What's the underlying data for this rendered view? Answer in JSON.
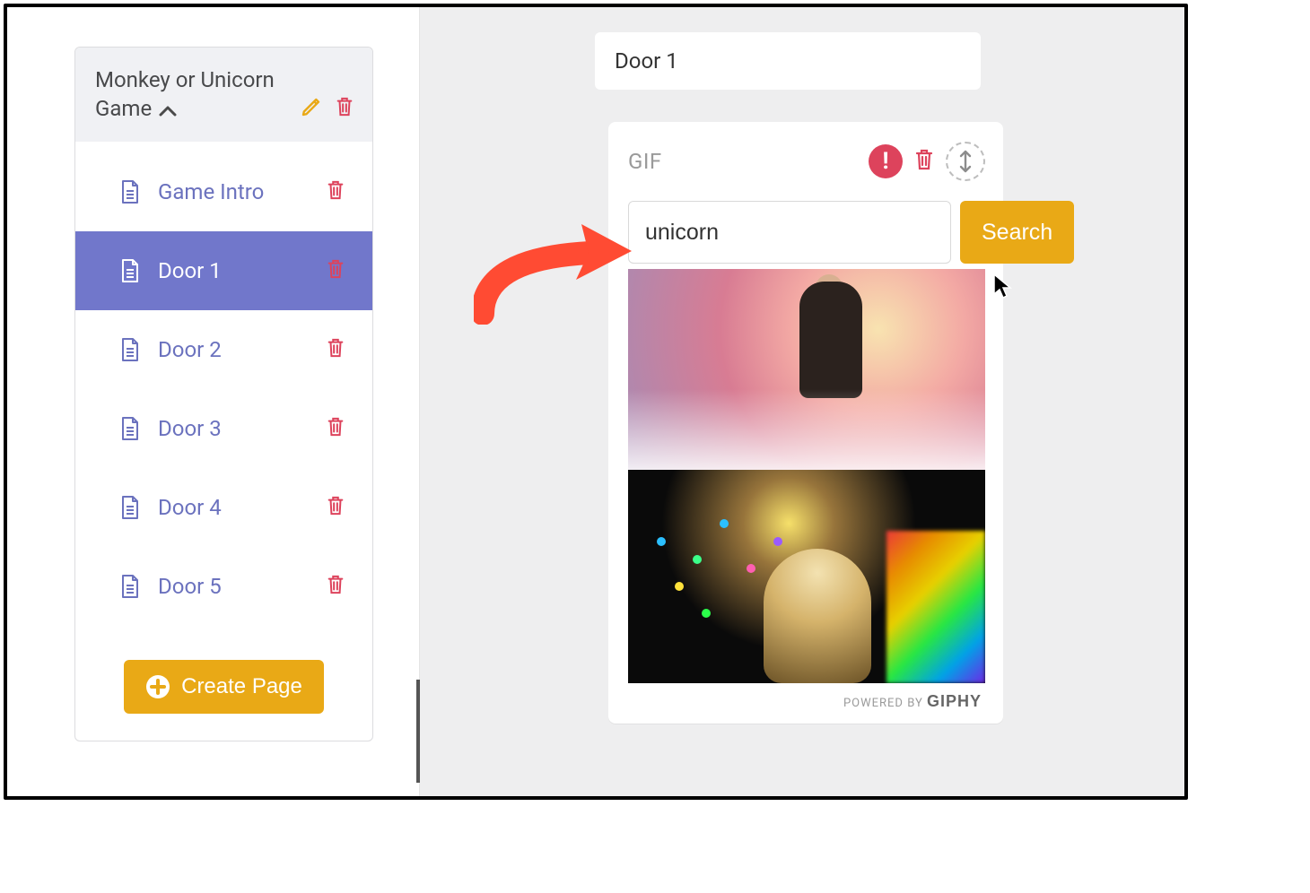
{
  "sidebar": {
    "title": "Monkey or Unicorn Game",
    "edit_label": "Edit",
    "delete_label": "Delete",
    "items": [
      {
        "label": "Game Intro",
        "active": false
      },
      {
        "label": "Door 1",
        "active": true
      },
      {
        "label": "Door 2",
        "active": false
      },
      {
        "label": "Door 3",
        "active": false
      },
      {
        "label": "Door 4",
        "active": false
      },
      {
        "label": "Door 5",
        "active": false
      }
    ],
    "create_label": "Create Page"
  },
  "page": {
    "title": "Door 1"
  },
  "gif_block": {
    "heading": "GIF",
    "search_value": "unicorn",
    "search_button": "Search",
    "powered_prefix": "POWERED BY",
    "powered_brand": "GIPHY"
  },
  "colors": {
    "accent_purple": "#7177cb",
    "accent_gold": "#e9a916",
    "danger": "#dd435c"
  }
}
